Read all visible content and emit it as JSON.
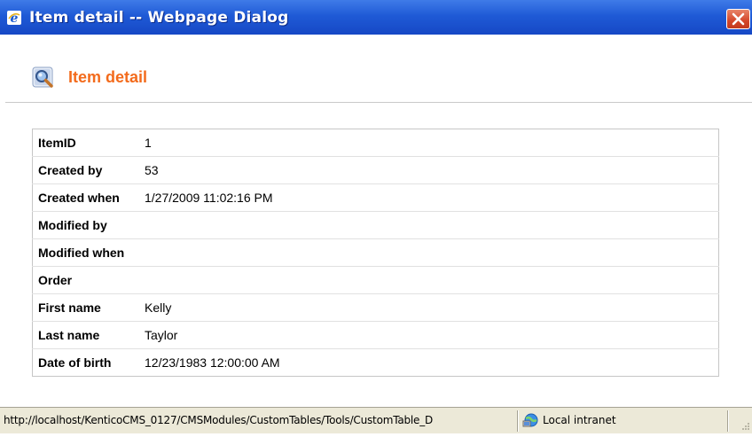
{
  "window": {
    "title": "Item detail -- Webpage Dialog",
    "title_icon": "ie-icon",
    "close_icon": "close-icon"
  },
  "header": {
    "icon": "magnifier-icon",
    "title": "Item detail"
  },
  "details": [
    {
      "label": "ItemID",
      "value": "1"
    },
    {
      "label": "Created by",
      "value": "53"
    },
    {
      "label": "Created when",
      "value": "1/27/2009 11:02:16 PM"
    },
    {
      "label": "Modified by",
      "value": ""
    },
    {
      "label": "Modified when",
      "value": ""
    },
    {
      "label": "Order",
      "value": ""
    },
    {
      "label": "First name",
      "value": "Kelly"
    },
    {
      "label": "Last name",
      "value": "Taylor"
    },
    {
      "label": "Date of birth",
      "value": "12/23/1983 12:00:00 AM"
    }
  ],
  "statusbar": {
    "url": "http://localhost/KenticoCMS_0127/CMSModules/CustomTables/Tools/CustomTable_D",
    "zone_icon": "local-intranet-icon",
    "zone": "Local intranet"
  },
  "colors": {
    "title_accent": "#f36b1c",
    "titlebar": "#1f5ad6"
  }
}
